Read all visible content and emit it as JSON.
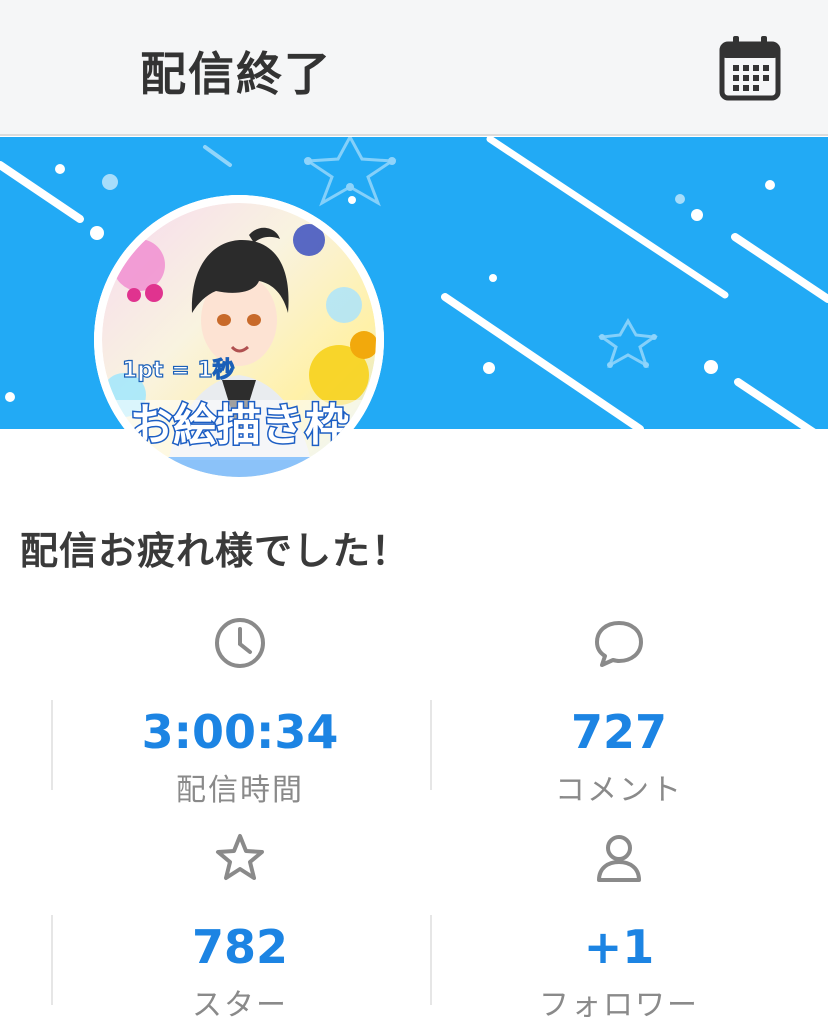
{
  "header": {
    "title": "配信終了",
    "calendar_icon": "calendar-icon"
  },
  "banner": {
    "color": "#22aaf5"
  },
  "avatar": {
    "overlay_text_small": "1pt = 1秒",
    "overlay_text_large": "お絵描き枠"
  },
  "message": "配信お疲れ様でした！",
  "stats": [
    {
      "icon": "clock-icon",
      "value": "3:00:34",
      "label": "配信時間"
    },
    {
      "icon": "comment-icon",
      "value": "727",
      "label": "コメント"
    },
    {
      "icon": "star-icon",
      "value": "782",
      "label": "スター"
    },
    {
      "icon": "person-icon",
      "value": "+1",
      "label": "フォロワー"
    }
  ],
  "colors": {
    "accent": "#1c84e3",
    "header_bg": "#f5f6f7",
    "banner_bg": "#22aaf5",
    "icon_gray": "#8a8a8a"
  }
}
